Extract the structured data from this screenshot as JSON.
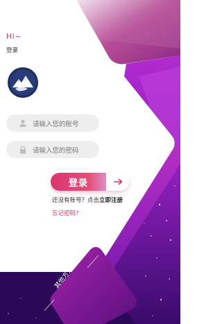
{
  "header": {
    "greeting": "Hi~",
    "subtitle": "登录"
  },
  "logo": {
    "icon": "mountain-logo-icon"
  },
  "form": {
    "username_placeholder": "请输入您的账号",
    "password_placeholder": "请输入您的密码",
    "username_icon": "user-icon",
    "password_icon": "lock-icon"
  },
  "login": {
    "label": "登录",
    "arrow_icon": "arrow-right-icon"
  },
  "register": {
    "prompt": "还没有账号？点击",
    "link": "立即注册"
  },
  "forgot": {
    "label": "忘记密码?"
  },
  "other_login": {
    "label": "其他方式登录"
  },
  "colors": {
    "accent": "#d9306a",
    "purple": "#8b1fb8",
    "dark_purple": "#3b0b6a"
  }
}
